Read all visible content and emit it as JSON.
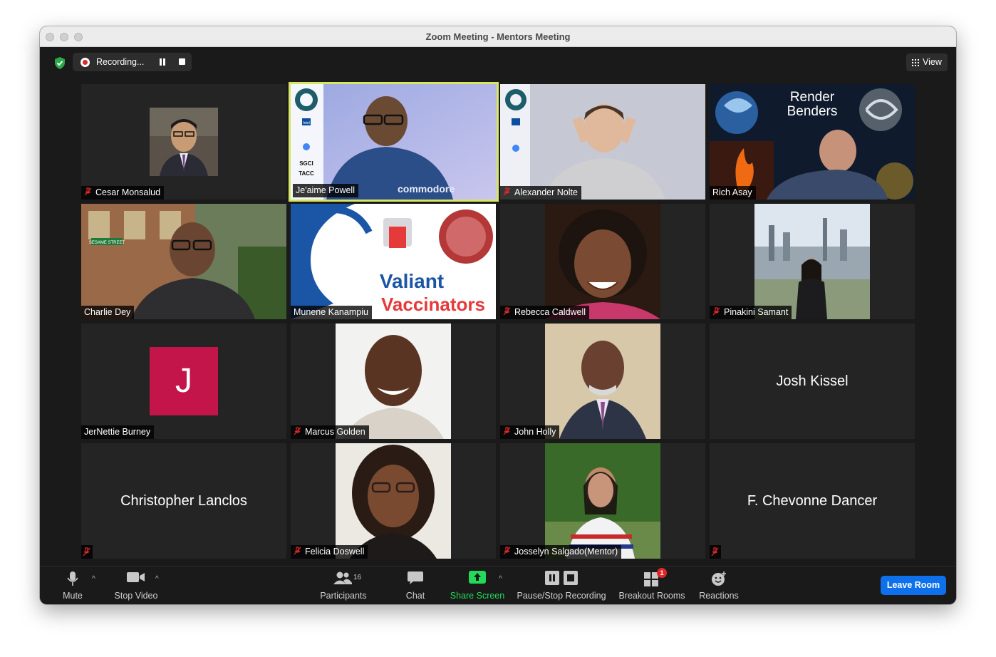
{
  "window": {
    "title": "Zoom Meeting - Mentors Meeting"
  },
  "topbar": {
    "recording_label": "Recording...",
    "view_label": "View"
  },
  "participants": [
    {
      "name": "Cesar Monsalud",
      "muted": true
    },
    {
      "name": "Je'aime Powell",
      "muted": false,
      "active_speaker": true,
      "backdrop_words": [
        "Intel",
        "SGCI",
        "TACC"
      ],
      "shirt_text": "commodore"
    },
    {
      "name": "Alexander Nolte",
      "muted": true
    },
    {
      "name": "Rich Asay",
      "muted": false,
      "backdrop_title": "Render Benders"
    },
    {
      "name": "Charlie Dey",
      "muted": false,
      "sign_text": "SESAME STREET"
    },
    {
      "name": "Munene Kanampiu",
      "muted": false,
      "poster_text": "Valiant Vaccinators"
    },
    {
      "name": "Rebecca Caldwell",
      "muted": true
    },
    {
      "name": "Pinakini Samant",
      "muted": true
    },
    {
      "name": "JerNettie Burney",
      "muted": false,
      "initial": "J"
    },
    {
      "name": "Marcus Golden",
      "muted": true
    },
    {
      "name": "John Holly",
      "muted": true
    },
    {
      "name": "Josh Kissel",
      "muted": false,
      "video_off": true
    },
    {
      "name": "Christopher Lanclos",
      "muted": true,
      "video_off": true
    },
    {
      "name": "Felicia Doswell",
      "muted": true
    },
    {
      "name": "Josselyn Salgado(Mentor)",
      "muted": true
    },
    {
      "name": "F. Chevonne Dancer",
      "muted": true,
      "video_off": true
    }
  ],
  "toolbar": {
    "mute": "Mute",
    "stop_video": "Stop Video",
    "participants": "Participants",
    "participant_count": "16",
    "chat": "Chat",
    "share_screen": "Share Screen",
    "pause_stop_recording": "Pause/Stop Recording",
    "breakout_rooms": "Breakout Rooms",
    "breakout_badge": "1",
    "reactions": "Reactions",
    "leave_room": "Leave Room"
  },
  "colors": {
    "share_green": "#23d959",
    "leave_blue": "#0e71eb",
    "active_border": "#d7e564",
    "avatar_J": "#c4154a",
    "mute_red": "#e02828"
  }
}
